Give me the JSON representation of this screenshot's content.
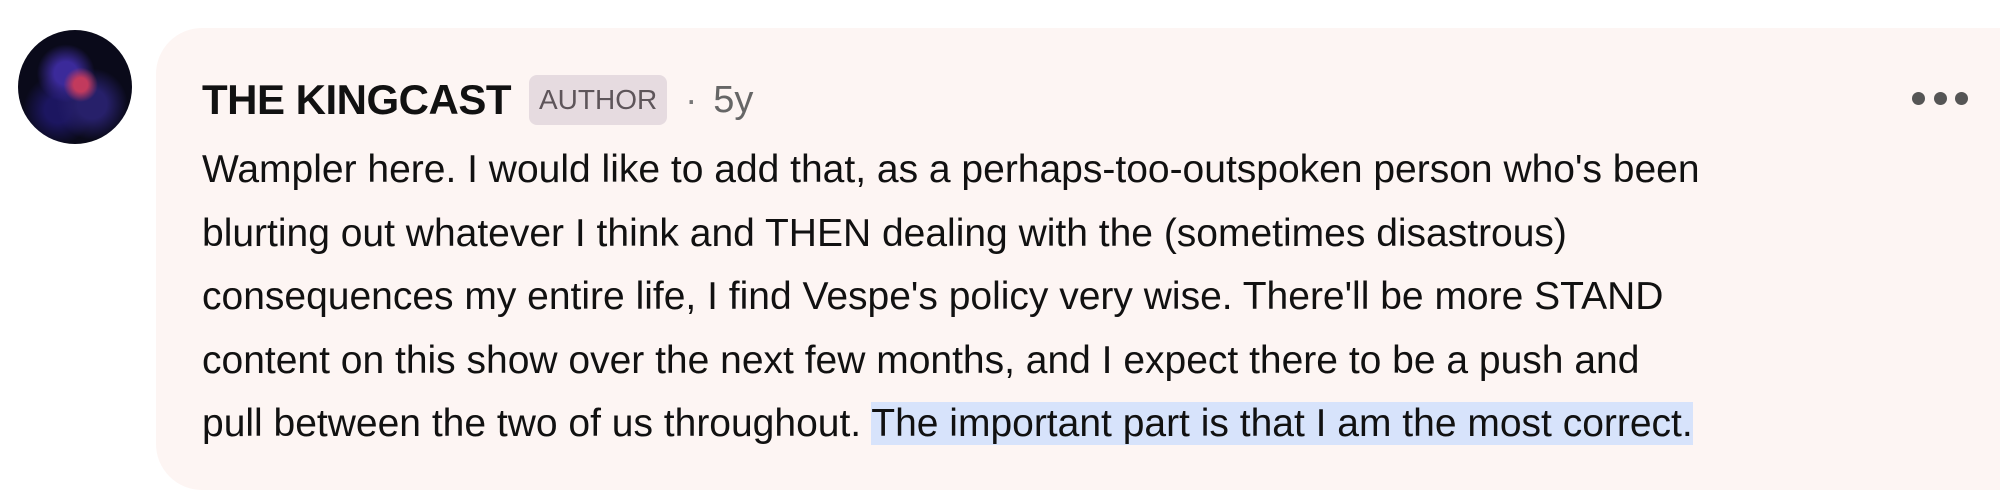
{
  "comment": {
    "author": "THE KINGCAST",
    "badge": "AUTHOR",
    "separator": "·",
    "time": "5y",
    "body_lines": [
      "Wampler here. I would like to add that, as a perhaps-too-outspoken person who's been",
      "blurting out whatever I think and THEN dealing with the (sometimes disastrous)",
      "consequences my entire life, I find Vespe's policy very wise. There'll be more STAND",
      "content on this show over the next few months, and I expect there to be a push and"
    ],
    "last_line_plain": "pull between the two of us throughout. ",
    "highlighted_text": "The important part is that I am the most correct.",
    "more_icon": "more-horizontal-icon",
    "highlight_color": "#d7e3fb",
    "background_color": "#fdf5f3"
  }
}
